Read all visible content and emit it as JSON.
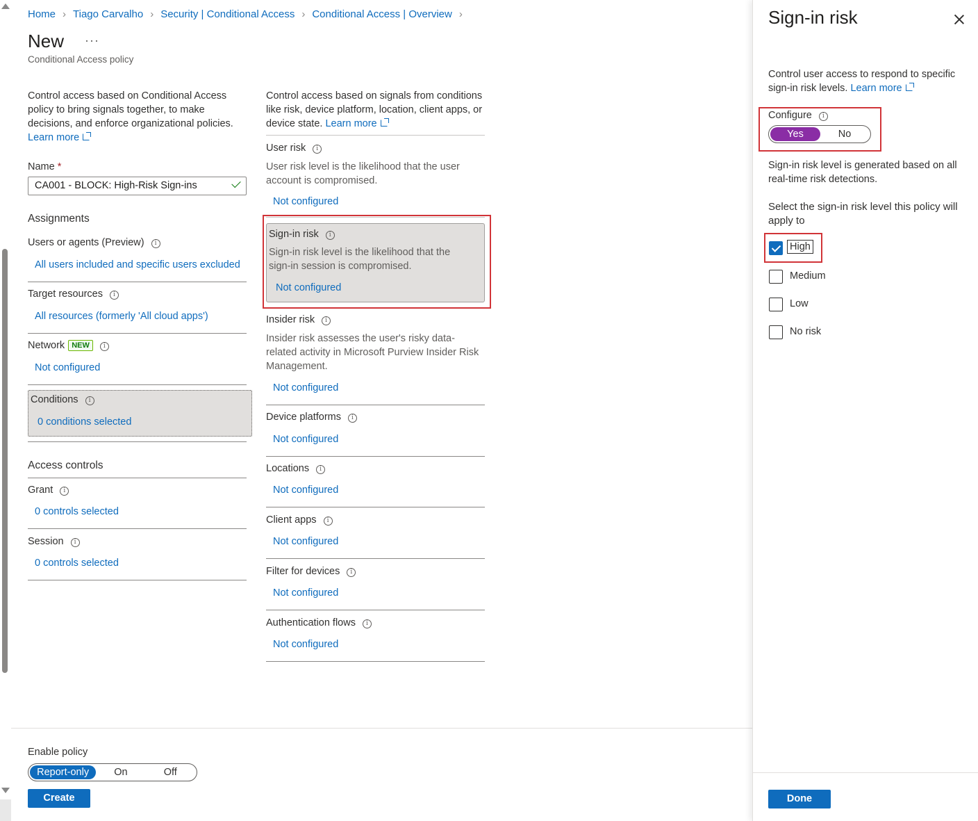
{
  "breadcrumb": [
    "Home",
    "Tiago Carvalho",
    "Security | Conditional Access",
    "Conditional Access | Overview"
  ],
  "page": {
    "title": "New",
    "more": "···",
    "subtitle": "Conditional Access policy"
  },
  "left": {
    "description": "Control access based on Conditional Access policy to bring signals together, to make decisions, and enforce organizational policies.",
    "learn_more": "Learn more",
    "name_label": "Name",
    "name_required": "*",
    "name_value": "CA001 - BLOCK: High-Risk Sign-ins",
    "assignments_heading": "Assignments",
    "users_label": "Users or agents (Preview)",
    "users_value": "All users included and specific users excluded",
    "target_label": "Target resources",
    "target_value": "All resources (formerly 'All cloud apps')",
    "network_label": "Network",
    "network_badge": "NEW",
    "network_value": "Not configured",
    "conditions_label": "Conditions",
    "conditions_value": "0 conditions selected",
    "access_heading": "Access controls",
    "grant_label": "Grant",
    "grant_value": "0 controls selected",
    "session_label": "Session",
    "session_value": "0 controls selected"
  },
  "middle": {
    "description": "Control access based on signals from conditions like risk, device platform, location, client apps, or device state.",
    "learn_more": "Learn more",
    "user_risk": {
      "label": "User risk",
      "desc": "User risk level is the likelihood that the user account is compromised.",
      "value": "Not configured"
    },
    "signin_risk": {
      "label": "Sign-in risk",
      "desc": "Sign-in risk level is the likelihood that the sign-in session is compromised.",
      "value": "Not configured"
    },
    "insider_risk": {
      "label": "Insider risk",
      "desc": "Insider risk assesses the user's risky data-related activity in Microsoft Purview Insider Risk Management.",
      "value": "Not configured"
    },
    "device_platforms": {
      "label": "Device platforms",
      "value": "Not configured"
    },
    "locations": {
      "label": "Locations",
      "value": "Not configured"
    },
    "client_apps": {
      "label": "Client apps",
      "value": "Not configured"
    },
    "filter_devices": {
      "label": "Filter for devices",
      "value": "Not configured"
    },
    "auth_flows": {
      "label": "Authentication flows",
      "value": "Not configured"
    }
  },
  "footer": {
    "enable_label": "Enable policy",
    "options": [
      "Report-only",
      "On",
      "Off"
    ],
    "selected": "Report-only",
    "create": "Create"
  },
  "panel": {
    "title": "Sign-in risk",
    "description": "Control user access to respond to specific sign-in risk levels.",
    "learn_more": "Learn more",
    "configure_label": "Configure",
    "configure_options": [
      "Yes",
      "No"
    ],
    "configure_selected": "Yes",
    "generated_text": "Sign-in risk level is generated based on all real-time risk detections.",
    "select_text": "Select the sign-in risk level this policy will apply to",
    "levels": [
      {
        "label": "High",
        "checked": true
      },
      {
        "label": "Medium",
        "checked": false
      },
      {
        "label": "Low",
        "checked": false
      },
      {
        "label": "No risk",
        "checked": false
      }
    ],
    "done": "Done"
  },
  "colors": {
    "link": "#0f6cbd",
    "accent_purple": "#8a2da5",
    "highlight_red": "#d13438"
  }
}
